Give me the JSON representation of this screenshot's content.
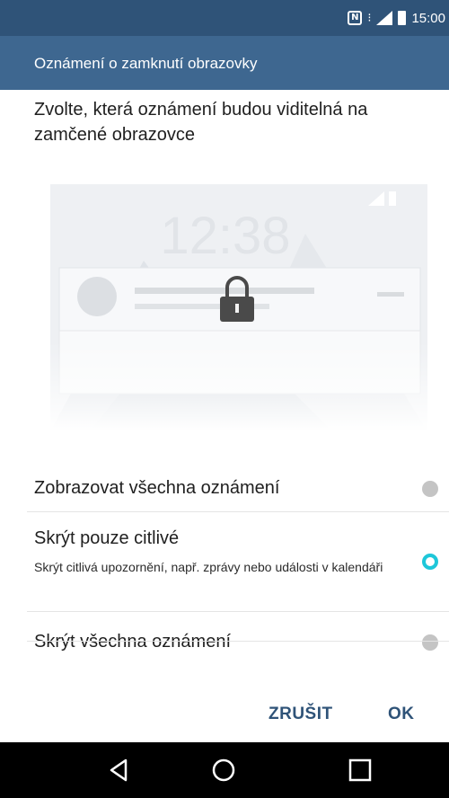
{
  "statusbar": {
    "nfc_text": "N",
    "time": "15:00",
    "icons": [
      "nfc-icon",
      "vibrate-icon",
      "signal-icon",
      "battery-icon"
    ]
  },
  "header": {
    "title": "Oznámení o zamknutí obrazovky"
  },
  "main": {
    "heading": "Zvolte, která oznámení budou viditelná na zamčené obrazovce",
    "illustration": {
      "clock": "12:38",
      "icon": "lock-icon"
    },
    "options": [
      {
        "label": "Zobrazovat všechna oznámení",
        "selected": false
      },
      {
        "label": "Skrýt pouze citlivé",
        "description": "Skrýt citlivá upozornění, např. zprávy nebo události v kalendáři",
        "selected": true
      },
      {
        "label": "Skrýt všechna oznámení",
        "selected": false
      }
    ]
  },
  "dialog_buttons": {
    "cancel": "ZRUŠIT",
    "ok": "OK"
  },
  "navbar": {
    "icons": [
      "back-icon",
      "home-icon",
      "recents-icon"
    ]
  },
  "colors": {
    "statusbar": "#2f5378",
    "titlebar": "#3e6790",
    "accent": "#1ec7d9",
    "button_text": "#2f5378"
  }
}
